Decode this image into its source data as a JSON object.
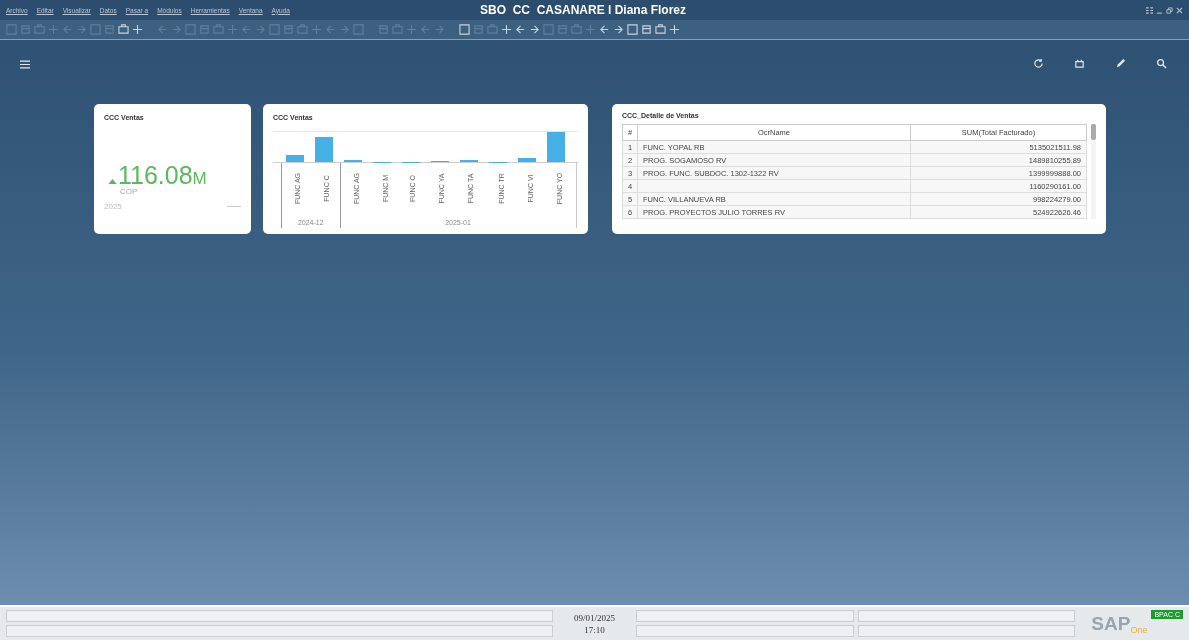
{
  "window": {
    "title": "SBO  CC  CASANARE l Diana Florez"
  },
  "menu": [
    "Archivo",
    "Editar",
    "Visualizar",
    "Datos",
    "Pasar a",
    "Módulos",
    "Herramientas",
    "Ventana",
    "Ayuda"
  ],
  "cards": [
    {
      "kind": "kpi",
      "title": "CCC Ventas",
      "value": "116.08",
      "unit": "M",
      "currency": "COP",
      "period": "2025"
    },
    {
      "kind": "chart",
      "title": "CCC Ventas",
      "groups": [
        {
          "label": "2024-12",
          "categories": [
            "FUNC AG",
            "FUNC C"
          ]
        },
        {
          "label": "2025-01",
          "categories": [
            "FUNC AG",
            "FUNC M",
            "FUNC O",
            "FUNC YA",
            "FUNC TA",
            "FUNC TR",
            "FUNC VI",
            "FUNC YO"
          ]
        }
      ]
    },
    {
      "kind": "table",
      "title": "CCC_Detalle de Ventas",
      "columns": [
        "#",
        "OcrName",
        "SUM(Total Facturado)"
      ],
      "rows": [
        [
          "1",
          "FUNC. YOPAL RB",
          "5135021511.98"
        ],
        [
          "2",
          "PROG. SOGAMOSO RV",
          "1489810255.89"
        ],
        [
          "3",
          "PROG. FUNC. SUBDOC. 1302-1322 RV",
          "1399999888.00"
        ],
        [
          "4",
          "",
          "1160290161.00"
        ],
        [
          "5",
          "FUNC. VILLANUEVA RB",
          "998224279.00"
        ],
        [
          "6",
          "PROG. PROYECTOS JULIO TORRES RV",
          "524922626.46"
        ]
      ]
    }
  ],
  "status_bar": {
    "date": "09/01/2025",
    "time": "17:10",
    "logo": "SAP",
    "logo_sub": "One",
    "badge": "BPAC C"
  }
}
